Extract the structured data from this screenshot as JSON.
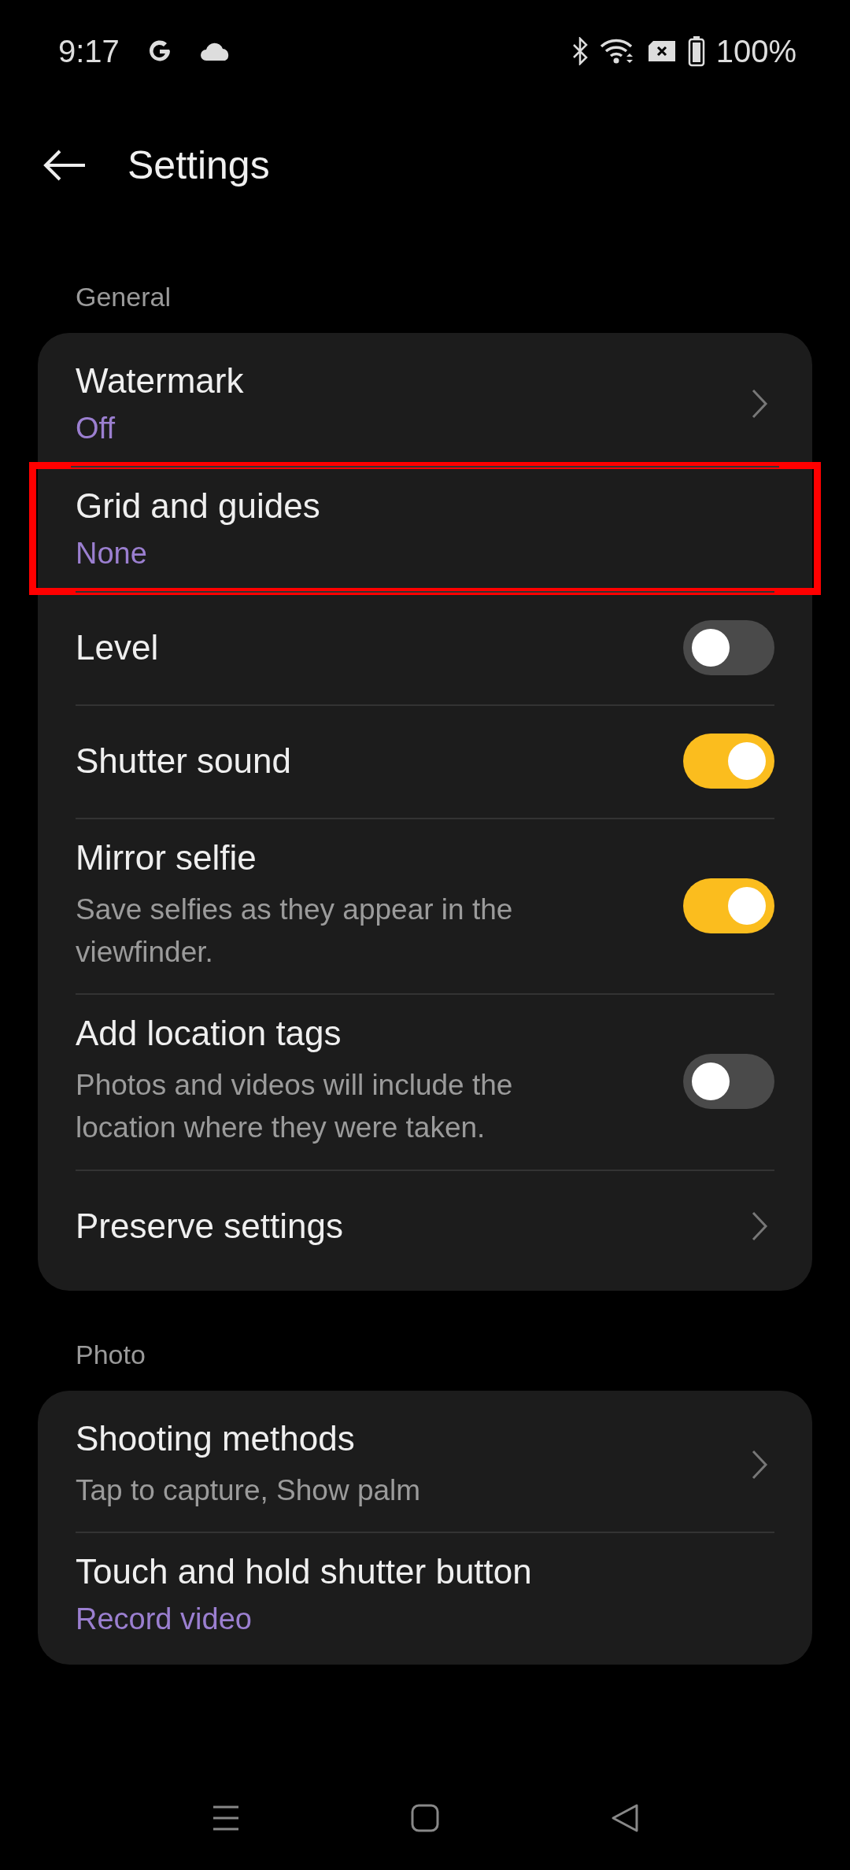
{
  "status_bar": {
    "time": "9:17",
    "battery": "100%"
  },
  "header": {
    "title": "Settings"
  },
  "sections": [
    {
      "title": "General",
      "items": [
        {
          "kind": "nav",
          "title": "Watermark",
          "value": "Off",
          "highlighted": false
        },
        {
          "kind": "plain",
          "title": "Grid and guides",
          "value": "None",
          "highlighted": true
        },
        {
          "kind": "toggle",
          "title": "Level",
          "on": false,
          "highlighted": false
        },
        {
          "kind": "toggle",
          "title": "Shutter sound",
          "on": true,
          "highlighted": false
        },
        {
          "kind": "toggle",
          "title": "Mirror selfie",
          "summary": "Save selfies as they appear in the viewfinder.",
          "on": true,
          "highlighted": false
        },
        {
          "kind": "toggle",
          "title": "Add location tags",
          "summary": "Photos and videos will include the location where they were taken.",
          "on": false,
          "highlighted": false
        },
        {
          "kind": "nav",
          "title": "Preserve settings",
          "highlighted": false
        }
      ]
    },
    {
      "title": "Photo",
      "items": [
        {
          "kind": "nav",
          "title": "Shooting methods",
          "summary": "Tap to capture, Show palm",
          "highlighted": false
        },
        {
          "kind": "plain",
          "title": "Touch and hold shutter button",
          "value": "Record video",
          "highlighted": false
        }
      ]
    }
  ]
}
